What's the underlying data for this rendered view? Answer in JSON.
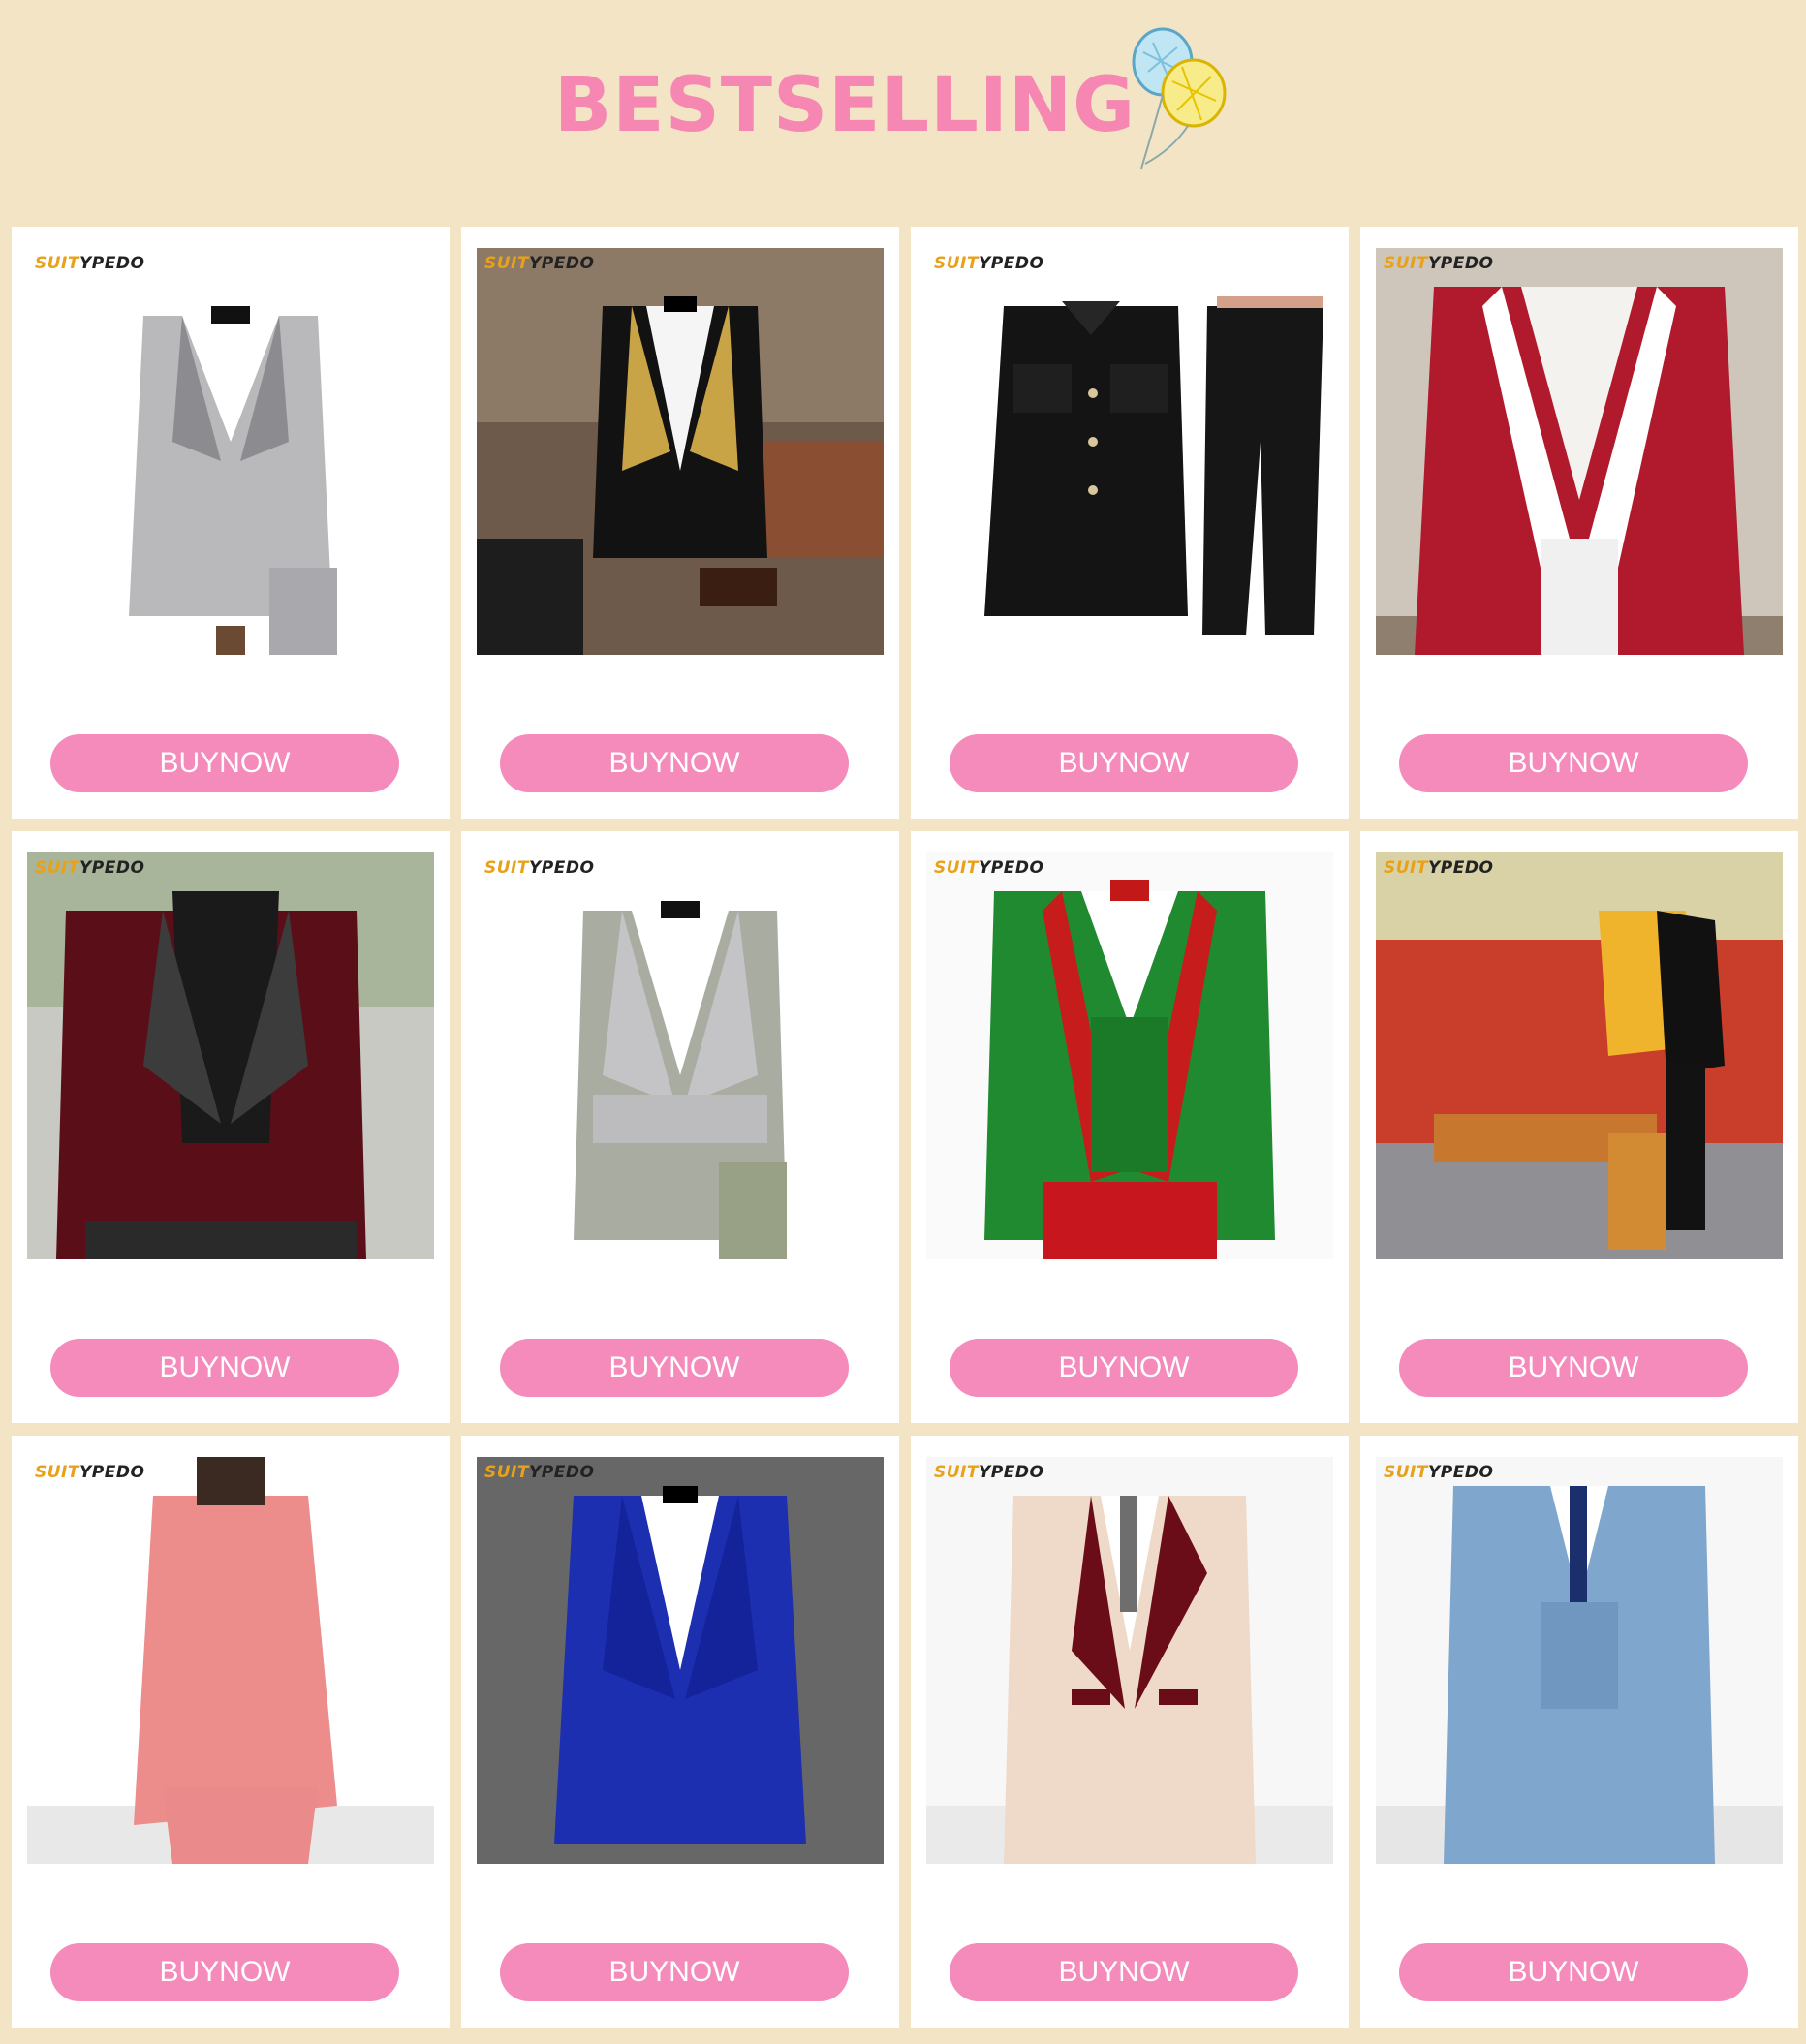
{
  "header": {
    "title": "BESTSELLING",
    "decoration_icon": "balloons-icon"
  },
  "brand_watermark": {
    "prefix": "SUIT",
    "suffix": "YPEDO"
  },
  "products": [
    {
      "button_label": "BUYNOW",
      "image": "grey-patterned-double-breasted-suit"
    },
    {
      "button_label": "BUYNOW",
      "image": "black-tuxedo-gold-lapel"
    },
    {
      "button_label": "BUYNOW",
      "image": "black-safari-suit"
    },
    {
      "button_label": "BUYNOW",
      "image": "red-jacquard-white-shawl-lapel"
    },
    {
      "button_label": "BUYNOW",
      "image": "burgundy-velvet-blazer"
    },
    {
      "button_label": "BUYNOW",
      "image": "silver-jacquard-smoking-jacket"
    },
    {
      "button_label": "BUYNOW",
      "image": "green-red-three-piece-suit"
    },
    {
      "button_label": "BUYNOW",
      "image": "yellow-black-sequin-blazer"
    },
    {
      "button_label": "BUYNOW",
      "image": "pink-asymmetric-kurta-suit"
    },
    {
      "button_label": "BUYNOW",
      "image": "royal-blue-velvet-tuxedo"
    },
    {
      "button_label": "BUYNOW",
      "image": "beige-burgundy-lapel-suit"
    },
    {
      "button_label": "BUYNOW",
      "image": "light-blue-three-piece-suit"
    }
  ],
  "colors": {
    "background": "#f4e4c6",
    "accent": "#f587b2",
    "button": "#f48bbb"
  }
}
